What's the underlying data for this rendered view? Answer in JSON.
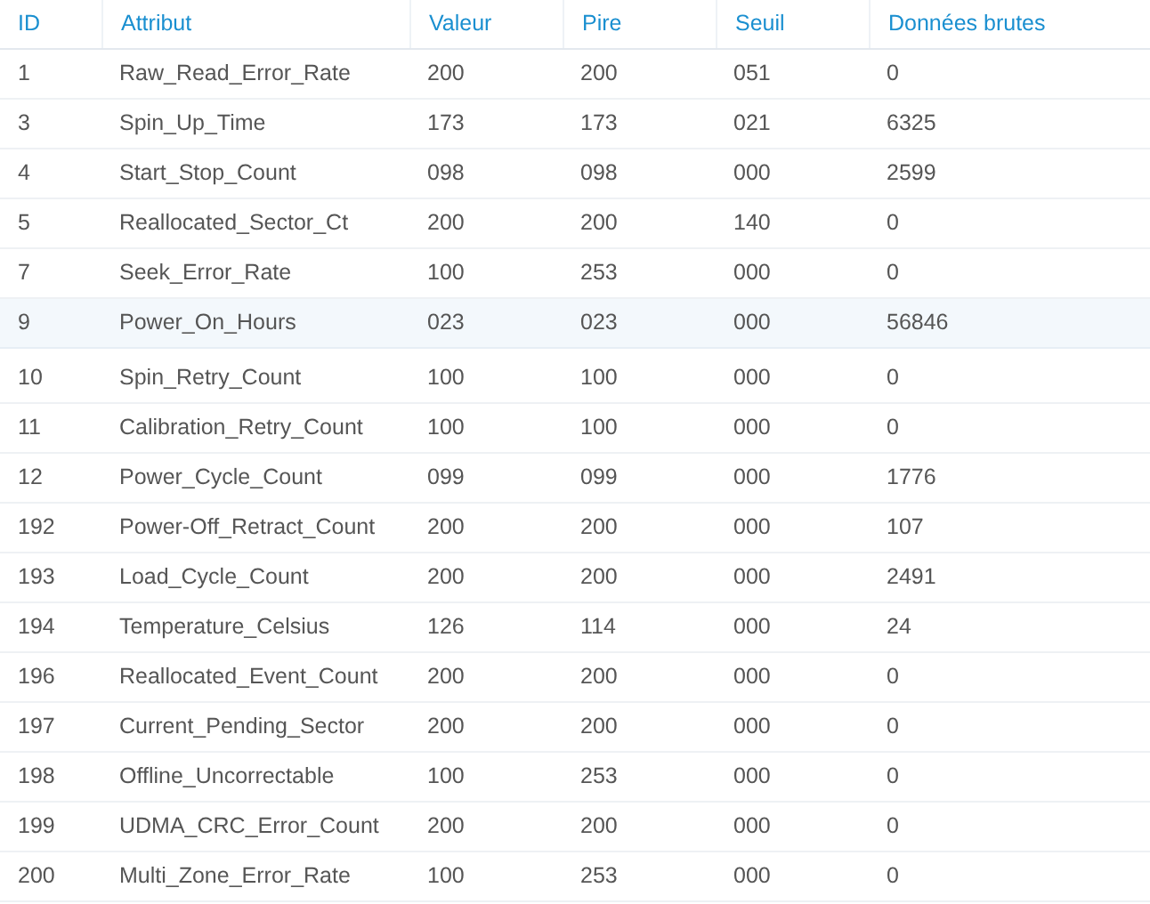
{
  "table": {
    "columns": [
      "ID",
      "Attribut",
      "Valeur",
      "Pire",
      "Seuil",
      "Données brutes"
    ],
    "rows": [
      {
        "cells": [
          "1",
          "Raw_Read_Error_Rate",
          "200",
          "200",
          "051",
          "0"
        ],
        "selected": false
      },
      {
        "cells": [
          "3",
          "Spin_Up_Time",
          "173",
          "173",
          "021",
          "6325"
        ],
        "selected": false
      },
      {
        "cells": [
          "4",
          "Start_Stop_Count",
          "098",
          "098",
          "000",
          "2599"
        ],
        "selected": false
      },
      {
        "cells": [
          "5",
          "Reallocated_Sector_Ct",
          "200",
          "200",
          "140",
          "0"
        ],
        "selected": false
      },
      {
        "cells": [
          "7",
          "Seek_Error_Rate",
          "100",
          "253",
          "000",
          "0"
        ],
        "selected": false
      },
      {
        "cells": [
          "9",
          "Power_On_Hours",
          "023",
          "023",
          "000",
          "56846"
        ],
        "selected": true
      },
      {
        "cells": [
          "10",
          "Spin_Retry_Count",
          "100",
          "100",
          "000",
          "0"
        ],
        "selected": false
      },
      {
        "cells": [
          "11",
          "Calibration_Retry_Count",
          "100",
          "100",
          "000",
          "0"
        ],
        "selected": false
      },
      {
        "cells": [
          "12",
          "Power_Cycle_Count",
          "099",
          "099",
          "000",
          "1776"
        ],
        "selected": false
      },
      {
        "cells": [
          "192",
          "Power-Off_Retract_Count",
          "200",
          "200",
          "000",
          "107"
        ],
        "selected": false
      },
      {
        "cells": [
          "193",
          "Load_Cycle_Count",
          "200",
          "200",
          "000",
          "2491"
        ],
        "selected": false
      },
      {
        "cells": [
          "194",
          "Temperature_Celsius",
          "126",
          "114",
          "000",
          "24"
        ],
        "selected": false
      },
      {
        "cells": [
          "196",
          "Reallocated_Event_Count",
          "200",
          "200",
          "000",
          "0"
        ],
        "selected": false
      },
      {
        "cells": [
          "197",
          "Current_Pending_Sector",
          "200",
          "200",
          "000",
          "0"
        ],
        "selected": false
      },
      {
        "cells": [
          "198",
          "Offline_Uncorrectable",
          "100",
          "253",
          "000",
          "0"
        ],
        "selected": false
      },
      {
        "cells": [
          "199",
          "UDMA_CRC_Error_Count",
          "200",
          "200",
          "000",
          "0"
        ],
        "selected": false
      },
      {
        "cells": [
          "200",
          "Multi_Zone_Error_Rate",
          "100",
          "253",
          "000",
          "0"
        ],
        "selected": false
      }
    ]
  }
}
